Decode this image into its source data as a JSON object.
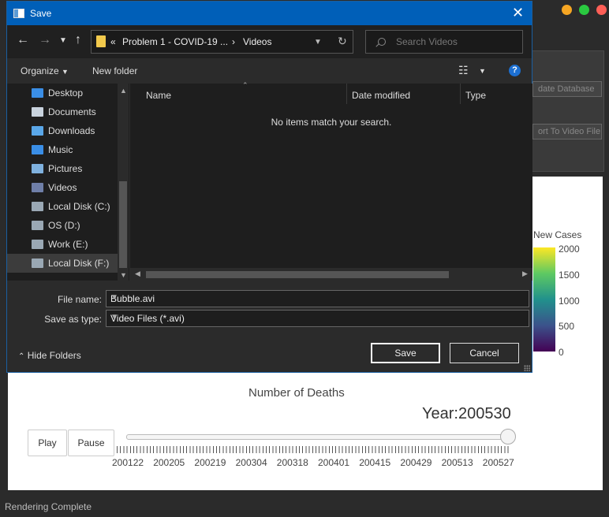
{
  "background": {
    "buttons": {
      "update_db": "date Database",
      "export_video": "ort To Video File"
    },
    "colorbar": {
      "title": "New Cases",
      "ticks": [
        "2000",
        "1500",
        "1000",
        "500",
        "0"
      ]
    },
    "x_axis_title": "Number of Deaths",
    "year_label": "Year:200530",
    "play_label": "Play",
    "pause_label": "Pause",
    "slider_value": 1.0,
    "slider_labels": [
      "200122",
      "200205",
      "200219",
      "200304",
      "200318",
      "200401",
      "200415",
      "200429",
      "200513",
      "200527"
    ],
    "status": "Rendering Complete"
  },
  "dialog": {
    "title": "Save",
    "breadcrumb": {
      "overflow": "«",
      "parent": "Problem 1 - COVID-19 ...",
      "separator": "›",
      "current": "Videos"
    },
    "search_placeholder": "Search Videos",
    "organize_label": "Organize",
    "new_folder_label": "New folder",
    "help_label": "?",
    "sidebar": [
      {
        "label": "Desktop",
        "icon": "desktop-icon",
        "color": "#3a8ee6"
      },
      {
        "label": "Documents",
        "icon": "documents-icon",
        "color": "#c9d3de"
      },
      {
        "label": "Downloads",
        "icon": "downloads-icon",
        "color": "#5aa7e8"
      },
      {
        "label": "Music",
        "icon": "music-icon",
        "color": "#3a8ee6"
      },
      {
        "label": "Pictures",
        "icon": "pictures-icon",
        "color": "#7fb1de"
      },
      {
        "label": "Videos",
        "icon": "videos-icon",
        "color": "#6f7fa8"
      },
      {
        "label": "Local Disk (C:)",
        "icon": "disk-icon",
        "color": "#9aa8b4"
      },
      {
        "label": "OS (D:)",
        "icon": "disk-icon",
        "color": "#9aa8b4"
      },
      {
        "label": "Work (E:)",
        "icon": "disk-icon",
        "color": "#9aa8b4"
      },
      {
        "label": "Local Disk (F:)",
        "icon": "disk-icon",
        "color": "#9aa8b4"
      }
    ],
    "columns": {
      "name": "Name",
      "date_modified": "Date modified",
      "type": "Type"
    },
    "empty_message": "No items match your search.",
    "file_name_label": "File name:",
    "file_name_value": "Bubble.avi",
    "save_type_label": "Save as type:",
    "save_type_value": "Video Files (*.avi)",
    "hide_folders_label": "Hide Folders",
    "save_label": "Save",
    "cancel_label": "Cancel"
  },
  "colors": {
    "title_bar": "#005fb8",
    "dialog_bg": "#2b2b2b",
    "accent": "#1c6fd1"
  }
}
